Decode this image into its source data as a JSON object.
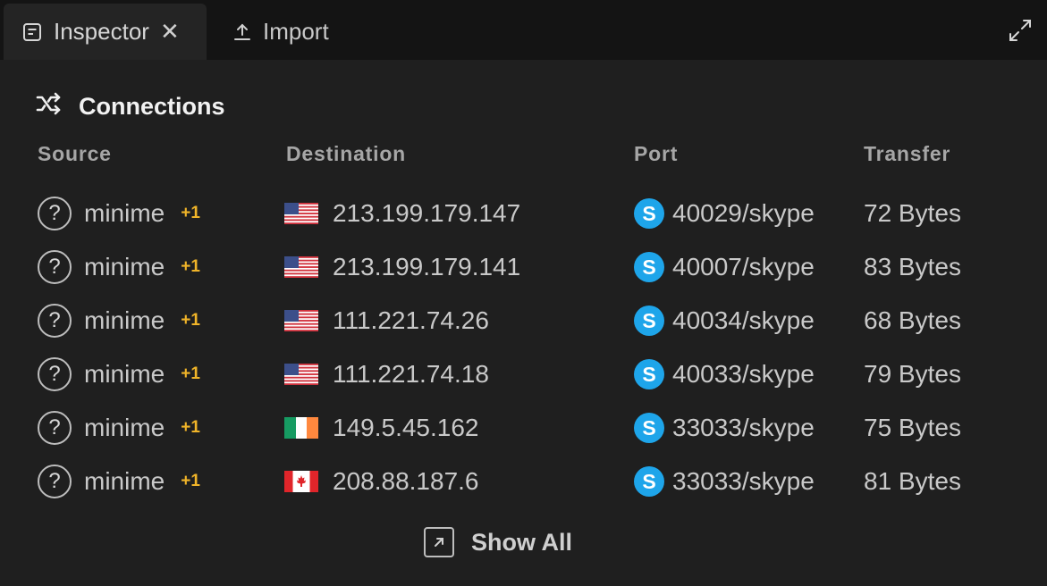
{
  "tabs": {
    "inspector": {
      "label": "Inspector",
      "close": "✕",
      "icon": "document-icon"
    },
    "import": {
      "label": "Import",
      "icon": "upload-icon"
    }
  },
  "maximize_icon": "expand-icon",
  "section": {
    "title": "Connections",
    "icon": "shuffle-icon"
  },
  "columns": {
    "source": "Source",
    "destination": "Destination",
    "port": "Port",
    "transfer": "Transfer"
  },
  "rows": [
    {
      "source": "minime",
      "extra": "+1",
      "flag": "us",
      "destination": "213.199.179.147",
      "port": "40029/skype",
      "transfer": "72 Bytes"
    },
    {
      "source": "minime",
      "extra": "+1",
      "flag": "us",
      "destination": "213.199.179.141",
      "port": "40007/skype",
      "transfer": "83 Bytes"
    },
    {
      "source": "minime",
      "extra": "+1",
      "flag": "us",
      "destination": "111.221.74.26",
      "port": "40034/skype",
      "transfer": "68 Bytes"
    },
    {
      "source": "minime",
      "extra": "+1",
      "flag": "us",
      "destination": "111.221.74.18",
      "port": "40033/skype",
      "transfer": "79 Bytes"
    },
    {
      "source": "minime",
      "extra": "+1",
      "flag": "ie",
      "destination": "149.5.45.162",
      "port": "33033/skype",
      "transfer": "75 Bytes"
    },
    {
      "source": "minime",
      "extra": "+1",
      "flag": "ca",
      "destination": "208.88.187.6",
      "port": "33033/skype",
      "transfer": "81 Bytes"
    }
  ],
  "show_all": {
    "label": "Show All",
    "icon": "external-link-icon"
  },
  "colors": {
    "accent_plus": "#f0b429",
    "skype": "#1ea5ea",
    "background": "#1f1f1f",
    "tabbar": "#141414"
  }
}
